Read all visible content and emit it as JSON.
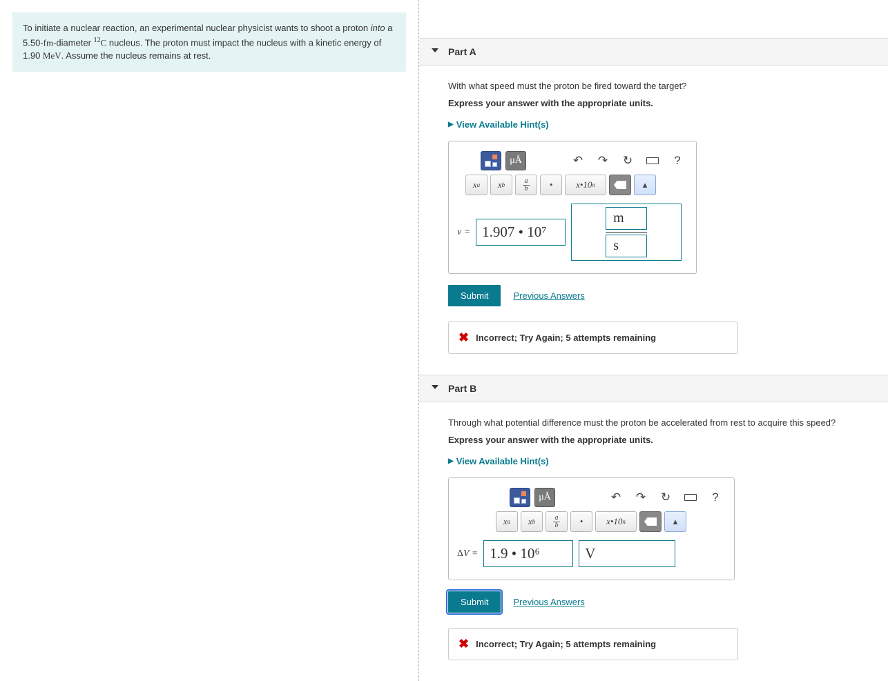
{
  "problem": {
    "intro": "To initiate a nuclear reaction, an experimental nuclear physicist wants to shoot a proton ",
    "intro_italic": "into",
    "intro2": " a 5.50-",
    "fm": "fm",
    "diameter": "-diameter ",
    "isotope_sup": "12",
    "isotope": "C",
    "intro3": " nucleus. The proton must impact the nucleus with a kinetic energy of 1.90 ",
    "mev": "MeV",
    "intro4": ". Assume the nucleus remains at rest."
  },
  "partA": {
    "title": "Part A",
    "question": "With what speed must the proton be fired toward the target?",
    "instruction": "Express your answer with the appropriate units.",
    "hints": "View Available Hint(s)",
    "var": "v",
    "equals": " = ",
    "value": "1.907 • 10⁷",
    "unit_num": "m",
    "unit_den": "s",
    "submit": "Submit",
    "prev": "Previous Answers",
    "feedback": "Incorrect; Try Again; 5 attempts remaining"
  },
  "partB": {
    "title": "Part B",
    "question": "Through what potential difference must the proton be accelerated from rest to acquire this speed?",
    "instruction": "Express your answer with the appropriate units.",
    "hints": "View Available Hint(s)",
    "var": "ΔV",
    "equals": " = ",
    "value": "1.9 • 10⁶",
    "unit": "V",
    "submit": "Submit",
    "prev": "Previous Answers",
    "feedback": "Incorrect; Try Again; 5 attempts remaining"
  },
  "toolbar": {
    "units_btn": "μÅ",
    "undo": "↶",
    "redo": "↷",
    "reset": "↻",
    "help": "?",
    "sup": "xᵃ",
    "sub": "xᵦ",
    "frac_a": "a",
    "frac_b": "b",
    "dot": "•",
    "sci": "x•10ⁿ"
  }
}
